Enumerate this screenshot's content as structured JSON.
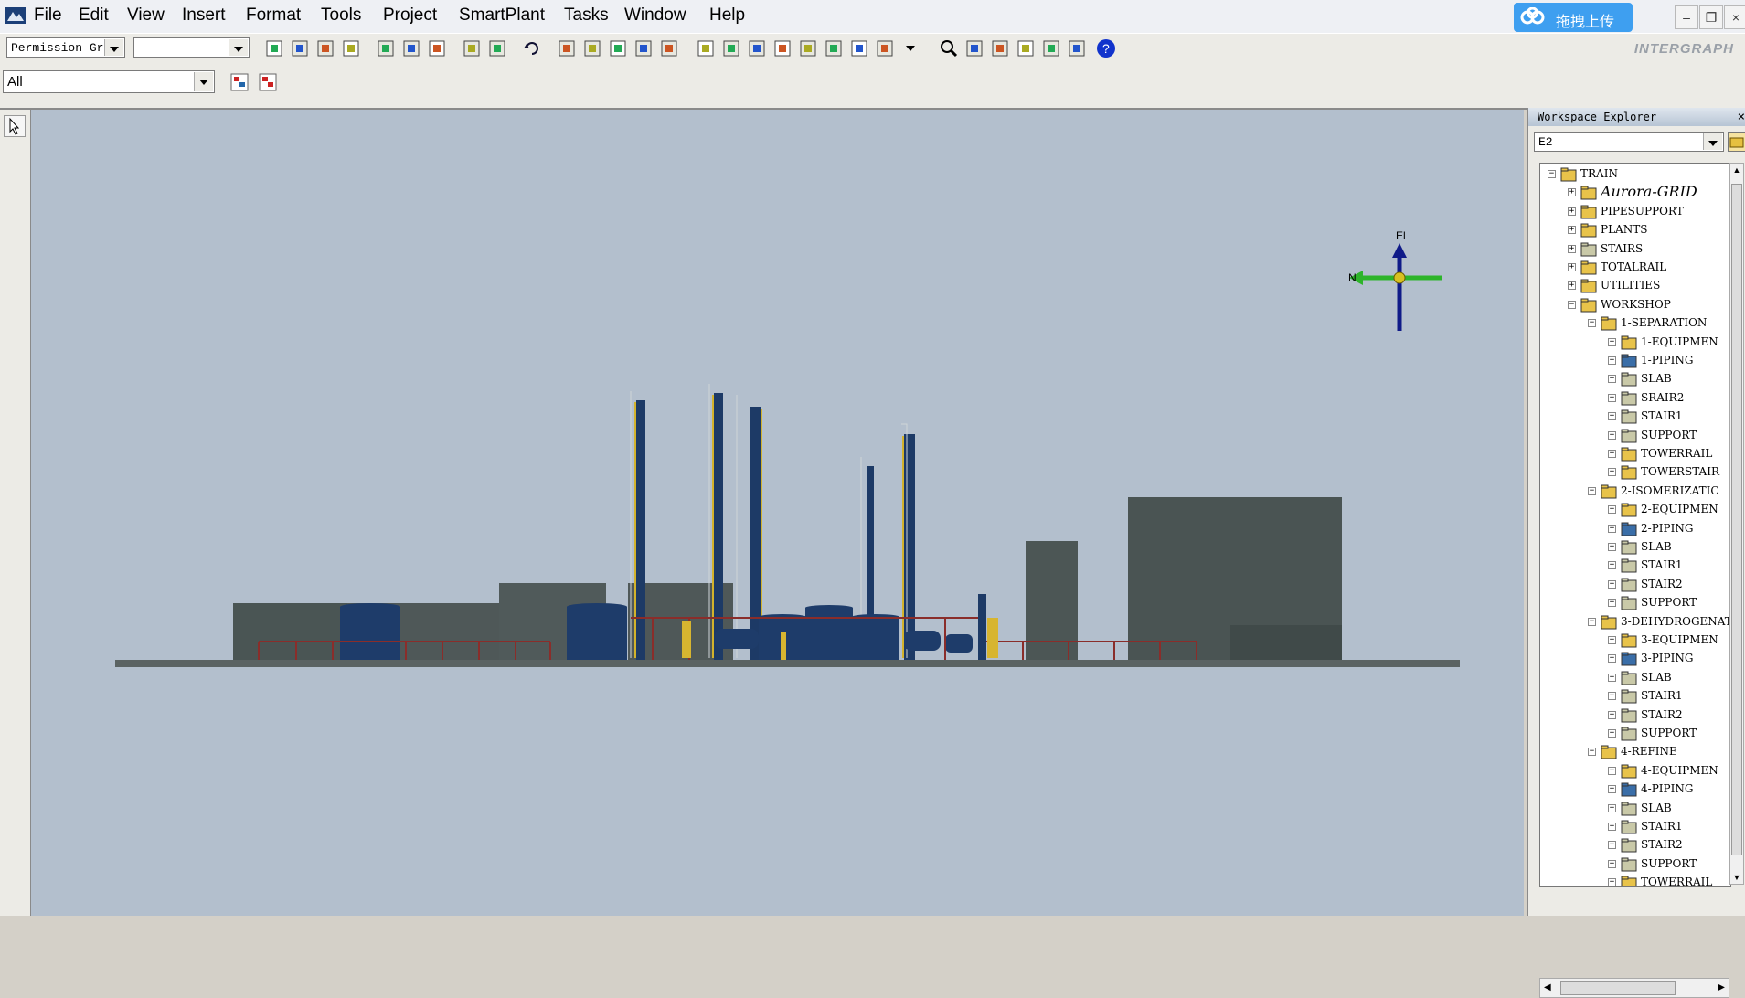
{
  "menubar": {
    "items": [
      "File",
      "Edit",
      "View",
      "Insert",
      "Format",
      "Tools",
      "Project",
      "SmartPlant",
      "Tasks",
      "Window",
      "Help"
    ],
    "cloud_upload_label": "拖拽上传",
    "window_buttons": [
      "–",
      "❐",
      "×"
    ]
  },
  "toolbar": {
    "permission_group": "Permission Gro",
    "second_combo": "",
    "filter_combo": "All",
    "vendor_logo": "INTERGRAPH"
  },
  "viewport": {
    "compass": {
      "up_label": "El",
      "left_label": "N"
    },
    "colors": {
      "background": "#b3bfcd",
      "tank": "#1e3c6a",
      "building": "#4a5554",
      "ground": "#5b6363",
      "rail": "#8a2d2a",
      "compass_blue": "#0f1a88",
      "compass_green": "#2db42a"
    }
  },
  "explorer": {
    "title": "Workspace Explorer",
    "close": "×",
    "combo_value": "E2",
    "tree": [
      {
        "label": "TRAIN",
        "level": 0,
        "icon": "root-icon",
        "exp": "−"
      },
      {
        "label": "Aurora-GRID",
        "level": 1,
        "icon": "folder-icon",
        "exp": "+",
        "fancy": true
      },
      {
        "label": "PIPESUPPORT",
        "level": 1,
        "icon": "folder-icon",
        "exp": "+"
      },
      {
        "label": "PLANTS",
        "level": 1,
        "icon": "folder-icon",
        "exp": "+"
      },
      {
        "label": "STAIRS",
        "level": 1,
        "icon": "stairs-icon",
        "exp": "+"
      },
      {
        "label": "TOTALRAIL",
        "level": 1,
        "icon": "folder-icon",
        "exp": "+"
      },
      {
        "label": "UTILITIES",
        "level": 1,
        "icon": "folder-icon",
        "exp": "+"
      },
      {
        "label": "WORKSHOP",
        "level": 1,
        "icon": "folder-icon",
        "exp": "−"
      },
      {
        "label": "1-SEPARATION",
        "level": 2,
        "icon": "folder-icon",
        "exp": "−"
      },
      {
        "label": "1-EQUIPMEN",
        "level": 3,
        "icon": "equipment-icon",
        "exp": "+"
      },
      {
        "label": "1-PIPING",
        "level": 3,
        "icon": "piping-icon",
        "exp": "+"
      },
      {
        "label": "SLAB",
        "level": 3,
        "icon": "stairs-icon",
        "exp": "+"
      },
      {
        "label": "SRAIR2",
        "level": 3,
        "icon": "stairs-icon",
        "exp": "+"
      },
      {
        "label": "STAIR1",
        "level": 3,
        "icon": "stairs-icon",
        "exp": "+"
      },
      {
        "label": "SUPPORT",
        "level": 3,
        "icon": "stairs-icon",
        "exp": "+"
      },
      {
        "label": "TOWERRAIL",
        "level": 3,
        "icon": "folder-icon",
        "exp": "+"
      },
      {
        "label": "TOWERSTAIR",
        "level": 3,
        "icon": "folder-icon",
        "exp": "+"
      },
      {
        "label": "2-ISOMERIZATIC",
        "level": 2,
        "icon": "folder-icon",
        "exp": "−"
      },
      {
        "label": "2-EQUIPMEN",
        "level": 3,
        "icon": "equipment-icon",
        "exp": "+"
      },
      {
        "label": "2-PIPING",
        "level": 3,
        "icon": "piping-icon",
        "exp": "+"
      },
      {
        "label": "SLAB",
        "level": 3,
        "icon": "stairs-icon",
        "exp": "+"
      },
      {
        "label": "STAIR1",
        "level": 3,
        "icon": "stairs-icon",
        "exp": "+"
      },
      {
        "label": "STAIR2",
        "level": 3,
        "icon": "stairs-icon",
        "exp": "+"
      },
      {
        "label": "SUPPORT",
        "level": 3,
        "icon": "stairs-icon",
        "exp": "+"
      },
      {
        "label": "3-DEHYDROGENAT",
        "level": 2,
        "icon": "folder-icon",
        "exp": "−"
      },
      {
        "label": "3-EQUIPMEN",
        "level": 3,
        "icon": "equipment-icon",
        "exp": "+"
      },
      {
        "label": "3-PIPING",
        "level": 3,
        "icon": "piping-icon",
        "exp": "+"
      },
      {
        "label": "SLAB",
        "level": 3,
        "icon": "stairs-icon",
        "exp": "+"
      },
      {
        "label": "STAIR1",
        "level": 3,
        "icon": "stairs-icon",
        "exp": "+"
      },
      {
        "label": "STAIR2",
        "level": 3,
        "icon": "stairs-icon",
        "exp": "+"
      },
      {
        "label": "SUPPORT",
        "level": 3,
        "icon": "stairs-icon",
        "exp": "+"
      },
      {
        "label": "4-REFINE",
        "level": 2,
        "icon": "folder-icon",
        "exp": "−"
      },
      {
        "label": "4-EQUIPMEN",
        "level": 3,
        "icon": "equipment-icon",
        "exp": "+"
      },
      {
        "label": "4-PIPING",
        "level": 3,
        "icon": "piping-icon",
        "exp": "+"
      },
      {
        "label": "SLAB",
        "level": 3,
        "icon": "stairs-icon",
        "exp": "+"
      },
      {
        "label": "STAIR1",
        "level": 3,
        "icon": "stairs-icon",
        "exp": "+"
      },
      {
        "label": "STAIR2",
        "level": 3,
        "icon": "stairs-icon",
        "exp": "+"
      },
      {
        "label": "SUPPORT",
        "level": 3,
        "icon": "stairs-icon",
        "exp": "+"
      },
      {
        "label": "TOWERRAIL",
        "level": 3,
        "icon": "folder-icon",
        "exp": "+"
      }
    ]
  }
}
